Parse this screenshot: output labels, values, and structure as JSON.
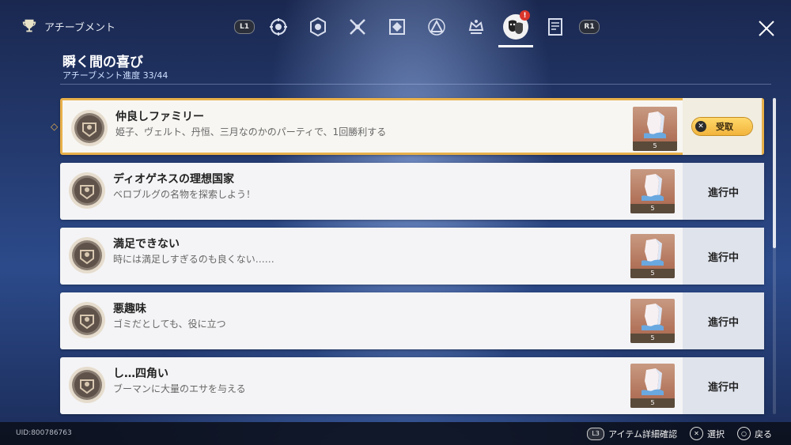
{
  "app": {
    "title": "アチーブメント"
  },
  "tabs": {
    "left_shoulder": "L1",
    "right_shoulder": "R1",
    "items": [
      {
        "icon": "helmet-gear-icon"
      },
      {
        "icon": "hexagon-emblem-icon"
      },
      {
        "icon": "crossed-swords-icon"
      },
      {
        "icon": "diamond-pattern-icon"
      },
      {
        "icon": "triangle-emblem-icon"
      },
      {
        "icon": "crown-emblem-icon"
      },
      {
        "icon": "masks-icon",
        "active": true,
        "alert": "!"
      },
      {
        "icon": "notebook-icon"
      }
    ]
  },
  "category": {
    "title": "瞬く間の喜び",
    "progress": "アチーブメント進度 33/44"
  },
  "achievements": [
    {
      "title": "仲良しファミリー",
      "desc": "姫子、ヴェルト、丹恒、三月なのかのパーティで、1回勝利する",
      "reward_count": "5",
      "status": "claim",
      "claim_label": "受取"
    },
    {
      "title": "ディオゲネスの理想国家",
      "desc": "ベロブルグの名物を探索しよう！",
      "reward_count": "5",
      "status": "進行中"
    },
    {
      "title": "満足できない",
      "desc": "時には満足しすぎるのも良くない……",
      "reward_count": "5",
      "status": "進行中"
    },
    {
      "title": "悪趣味",
      "desc": "ゴミだとしても、役に立つ",
      "reward_count": "5",
      "status": "進行中"
    },
    {
      "title": "し…四角い",
      "desc": "ブーマンに大量のエサを与える",
      "reward_count": "5",
      "status": "進行中"
    }
  ],
  "footer": {
    "uid": "UID:800786763",
    "hint_details_key": "L3",
    "hint_details": "アイテム詳細確認",
    "hint_select": "選択",
    "hint_back": "戻る"
  },
  "colors": {
    "accent": "#e8b04a",
    "claim": "#f2b43c",
    "alert": "#d9352c"
  }
}
